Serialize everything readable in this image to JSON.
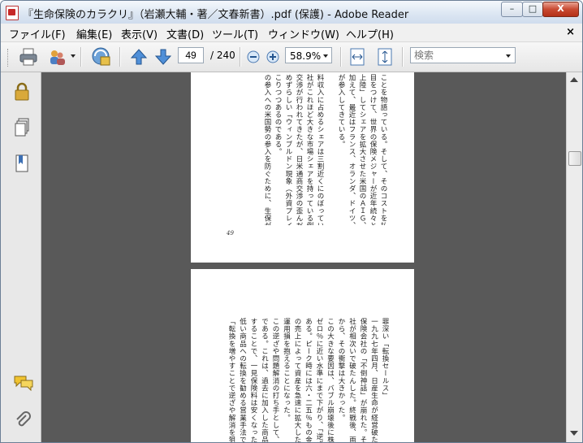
{
  "window": {
    "title": "『生命保険のカラクリ』（岩瀬大輔・著／文春新書）.pdf (保護) - Adobe Reader"
  },
  "caption_buttons": {
    "minimize": "–",
    "maximize": "□",
    "close": "X"
  },
  "menubar": {
    "items": [
      "ファイル(F)",
      "編集(E)",
      "表示(V)",
      "文書(D)",
      "ツール(T)",
      "ウィンドウ(W)",
      "ヘルプ(H)"
    ],
    "close": "×"
  },
  "toolbar": {
    "page_current": "49",
    "page_total": "/ 240",
    "zoom": "58.9%",
    "search_placeholder": "検索"
  },
  "sidebar": {
    "icons": [
      "lock-icon",
      "pages-icon",
      "bookmarks-icon",
      "comments-icon",
      "attachments-icon"
    ]
  },
  "document": {
    "page1": {
      "columns": [
        "ことを物語っている。そして、そのコストを払わ",
        "目をつけて、世界の保険メジャーが近年続々と",
        "上陸」してシェアを拡大させた米国のＡＩＧ、ア",
        "加えて、最近はフランス、オランダ、ドイツ、",
        "が参入してきている。",
        "",
        "料収入に占めるシェアは三割近くにのぼっている。",
        "社がこれほど大きな市場シェアを持っている例は",
        "交渉が行われてきたが、日米通商交渉の歪んだ結果",
        "めずらしい「ウィンブルドン現象（外資プレイ",
        "こりつつあるのである。",
        "の参入への米国勢の参入を防ぐために、生保が差し"
      ],
      "page_number": "49"
    },
    "page2": {
      "columns": [
        "罪深い「転換セールス」",
        "一九九七年四月、日産生命が経営破たん",
        "保険会社の「不倒神話」が崩れた。それか",
        "社が相次いで破たんした。終戦後、両",
        "から、その衝撃は大きかった。",
        "この大きな要因は、バブル崩壊後に株価",
        "ゼロ％に近い水準にまで下がり、「逆ざや",
        "ある。ピーク時には六・二五％もの金利を",
        "の売上によって資産を急速に拡大した生保",
        "運用損を抱えることになった。",
        "この逆ざや問題解消の打ち手として、",
        "である。これは、過去に加入した商品で",
        "することで、一見保険料は安くなったよう",
        "低い商品への転換を勧める営業手法である",
        "「転換を増やすことで逆ざや解消を狙っ"
      ]
    }
  }
}
